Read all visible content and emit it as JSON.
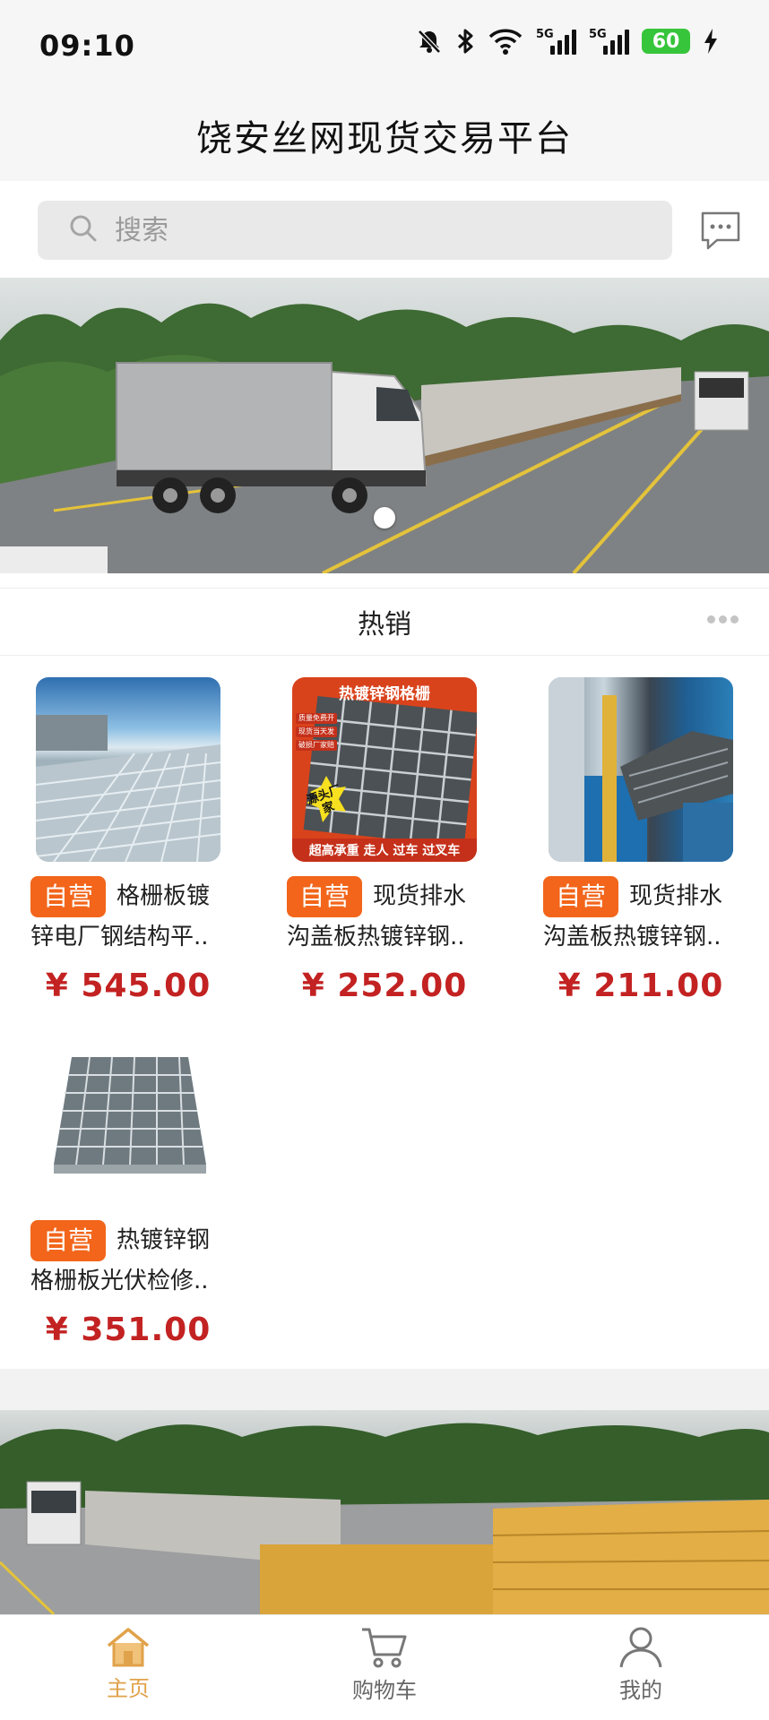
{
  "status_bar": {
    "time": "09:10",
    "battery": "60",
    "net1": "5G",
    "net2": "5G"
  },
  "header": {
    "title": "饶安丝网现货交易平台"
  },
  "search": {
    "placeholder": "搜索"
  },
  "section": {
    "title": "热销"
  },
  "products": [
    {
      "badge": "自营",
      "title": "格栅板镀锌电厂钢结构平..",
      "price": "¥ 545.00"
    },
    {
      "badge": "自营",
      "title": "现货排水沟盖板热镀锌钢..",
      "price": "¥ 252.00",
      "image_caption_top": "热镀锌钢格栅",
      "image_caption_bottom": "超高承重 走人 过车 过叉车",
      "image_tags": [
        "质量免费开",
        "现货当天发",
        "破损厂家赔"
      ],
      "image_burst": "源头厂家"
    },
    {
      "badge": "自营",
      "title": "现货排水沟盖板热镀锌钢..",
      "price": "¥ 211.00"
    },
    {
      "badge": "自营",
      "title": "热镀锌钢格栅板光伏检修..",
      "price": "¥ 351.00"
    }
  ],
  "nav": [
    {
      "label": "主页",
      "icon": "home-icon",
      "active": true
    },
    {
      "label": "购物车",
      "icon": "cart-icon",
      "active": false
    },
    {
      "label": "我的",
      "icon": "user-icon",
      "active": false
    }
  ],
  "colors": {
    "badge": "#f2651a",
    "price": "#c32222",
    "nav_active": "#e0a24a"
  }
}
